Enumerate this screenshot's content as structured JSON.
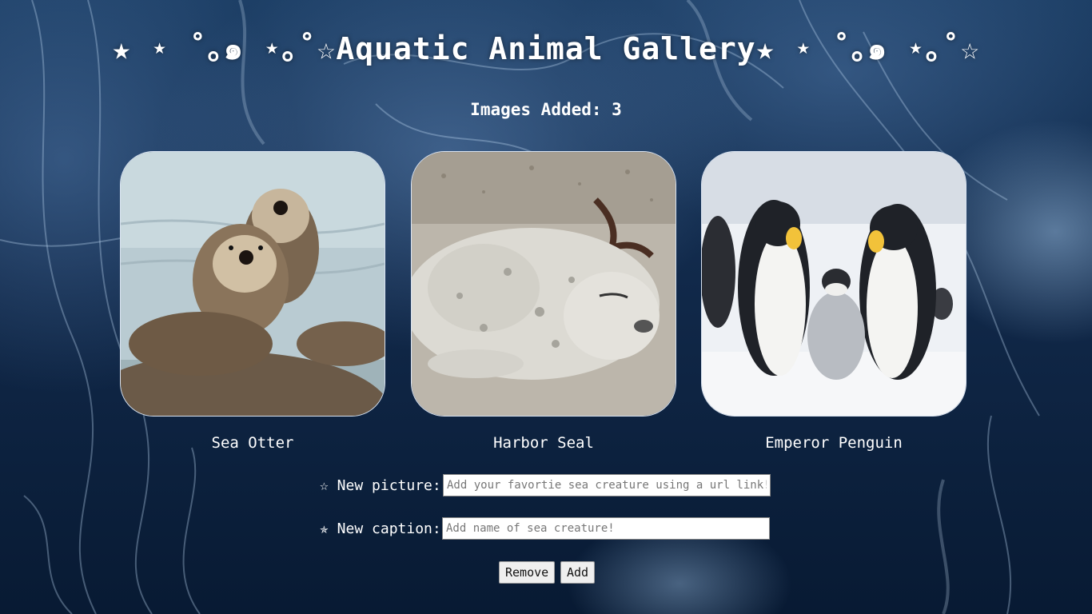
{
  "header": {
    "title": "★ ⋆ ˚｡๑ ⋆｡˚☆Aquatic Animal Gallery★ ⋆ ˚｡๑ ⋆｡˚☆"
  },
  "counter": {
    "text": "Images Added: 3"
  },
  "gallery": {
    "items": [
      {
        "caption": "Sea Otter",
        "image": "sea-otter-photo"
      },
      {
        "caption": "Harbor Seal",
        "image": "harbor-seal-photo"
      },
      {
        "caption": "Emperor Penguin",
        "image": "emperor-penguin-photo"
      }
    ]
  },
  "form": {
    "picture_label": "☆ New picture:",
    "picture_placeholder": "Add your favortie sea creature using a url link!",
    "caption_label": "✯ New caption:",
    "caption_placeholder": "Add name of sea creature!",
    "remove_label": "Remove",
    "add_label": "Add"
  },
  "colors": {
    "background_deep": "#081a33",
    "background_light": "#1d3f66",
    "text": "#ffffff"
  }
}
